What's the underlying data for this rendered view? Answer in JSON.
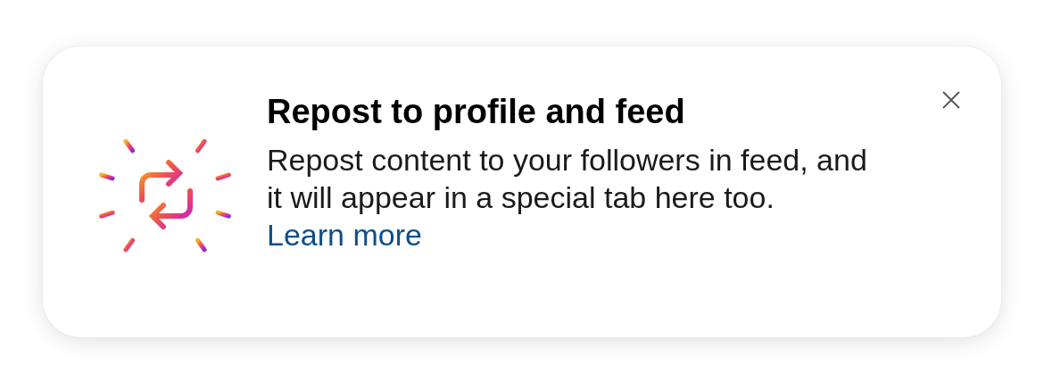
{
  "card": {
    "title": "Repost to profile and feed",
    "body": "Repost content to your followers in feed, and it will appear in a special tab here too.",
    "link": "Learn more"
  }
}
